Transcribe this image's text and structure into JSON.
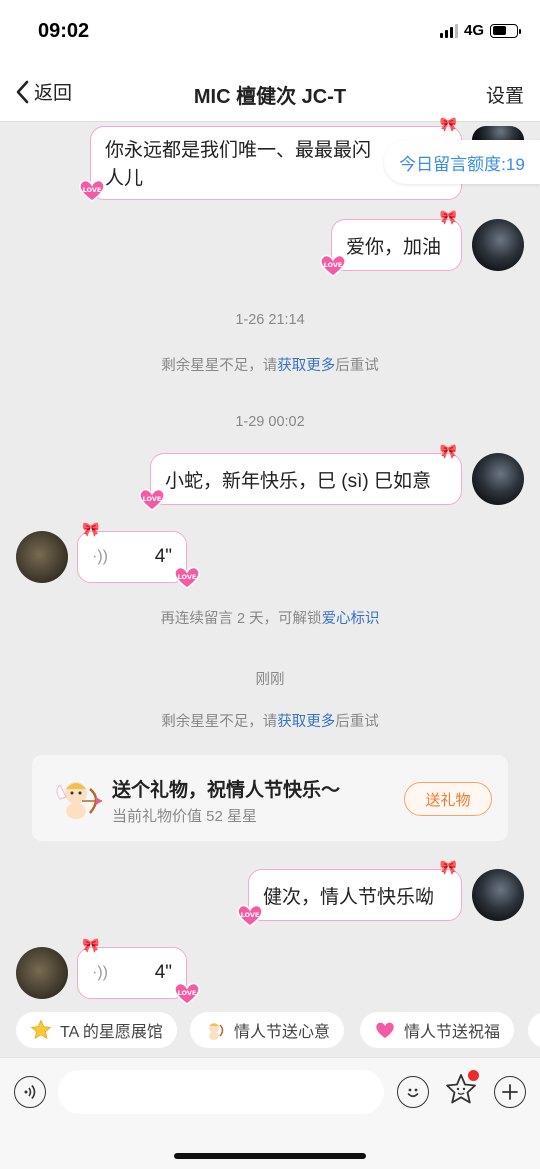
{
  "status_bar": {
    "time": "09:02",
    "network": "4G"
  },
  "nav": {
    "back_label": "返回",
    "title": "MIC 檀健次 JC-T",
    "settings_label": "设置"
  },
  "quota_badge": "今日留言额度:19",
  "messages": {
    "m1_line1": "你永远都是我们唯一、最最最",
    "m1_line1_cut": "闪",
    "m1_line2": "人儿",
    "m2": "爱你，加油",
    "m3": "小蛇，新年快乐，巳 (sì) 巳如意",
    "voice1_duration": "4\"",
    "m4": "健次，情人节快乐呦",
    "voice2_duration": "4\""
  },
  "system": {
    "time1": "1-26 21:14",
    "insufficient_prefix": "剩余星星不足，请",
    "insufficient_link": "获取更多",
    "insufficient_suffix": "后重试",
    "time2": "1-29 00:02",
    "unlock_prefix": "再连续留言 2 天，可解锁",
    "unlock_link": "爱心标识",
    "time3": "刚刚"
  },
  "gift_card": {
    "title": "送个礼物，祝情人节快乐～",
    "subtitle": "当前礼物价值 52 星星",
    "button_label": "送礼物"
  },
  "quick_actions": [
    {
      "label": "TA 的星愿展馆",
      "icon": "star-icon"
    },
    {
      "label": "情人节送心意",
      "icon": "cupid-icon"
    },
    {
      "label": "情人节送祝福",
      "icon": "heart-icon"
    }
  ],
  "input": {
    "placeholder": ""
  },
  "colors": {
    "bubble_border": "#f4a9d0",
    "link": "#3a71c4",
    "quota_text": "#3b8de6",
    "gift_button": "#f07a2c",
    "notification_dot": "#ee2b2b"
  },
  "icons": {
    "voice": "voice-wave-icon",
    "emoji": "smiley-icon",
    "star_face": "star-face-icon",
    "add": "plus-icon",
    "love_sticker": "love-heart-sticker-icon",
    "bow": "pink-bow-icon"
  }
}
